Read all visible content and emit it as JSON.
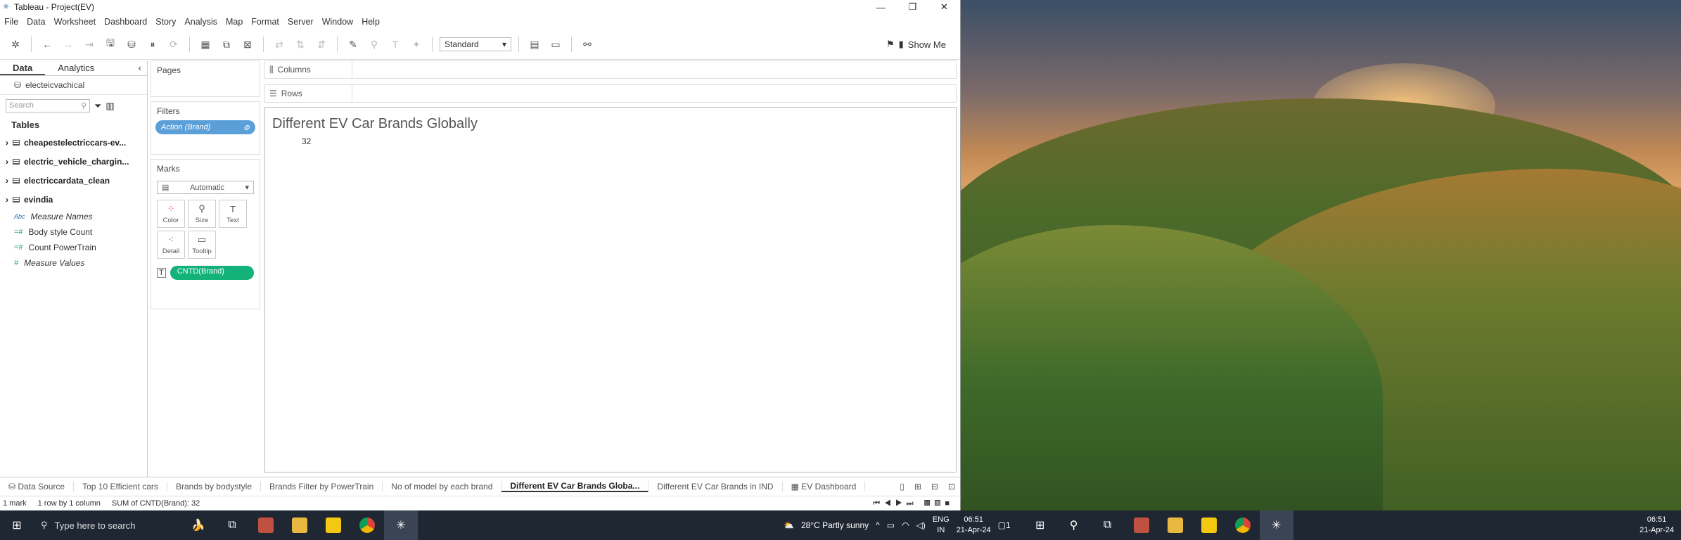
{
  "window": {
    "title": "Tableau - Project(EV)"
  },
  "menu": [
    "File",
    "Data",
    "Worksheet",
    "Dashboard",
    "Story",
    "Analysis",
    "Map",
    "Format",
    "Server",
    "Window",
    "Help"
  ],
  "toolbar": {
    "standard": "Standard",
    "showme": "Show Me"
  },
  "leftpane": {
    "tab_data": "Data",
    "tab_analytics": "Analytics",
    "datasource": "electeicvachical",
    "search_placeholder": "Search",
    "tables_title": "Tables",
    "tables": [
      "cheapestelectriccars-ev...",
      "electric_vehicle_chargin...",
      "electriccardata_clean",
      "evindia"
    ],
    "fields": [
      {
        "label": "Measure Names",
        "type": "abc"
      },
      {
        "label": "Body style Count",
        "type": "num"
      },
      {
        "label": "Count PowerTrain",
        "type": "num"
      },
      {
        "label": "Measure Values",
        "type": "num"
      }
    ]
  },
  "cards": {
    "pages": "Pages",
    "filters": "Filters",
    "filter_pill": "Action (Brand)",
    "marks": "Marks",
    "marks_type": "Automatic",
    "mark_buttons": [
      "Color",
      "Size",
      "Text",
      "Detail",
      "Tooltip"
    ],
    "cntd_pill": "CNTD(Brand)"
  },
  "shelves": {
    "columns": "Columns",
    "rows": "Rows"
  },
  "view": {
    "title": "Different EV Car Brands  Globally",
    "value": "32"
  },
  "sheettabs": [
    "Data Source",
    "Top 10 Efficient  cars",
    "Brands by bodystyle",
    "Brands Filter by PowerTrain",
    "No of model by each brand",
    "Different EV Car Brands  Globa...",
    "Different EV Car Brands in IND",
    "EV Dashboard"
  ],
  "active_tab_index": 5,
  "status": {
    "marks": "1 mark",
    "dims": "1 row by 1 column",
    "sum": "SUM of CNTD(Brand): 32"
  },
  "taskbar": {
    "search": "Type here to search",
    "weather": "28°C  Partly sunny",
    "lang1": "ENG",
    "lang2": "IN",
    "time1": "06:51",
    "date1": "21-Apr-24",
    "time2": "06:51",
    "date2": "21-Apr-24",
    "notif": "1"
  }
}
